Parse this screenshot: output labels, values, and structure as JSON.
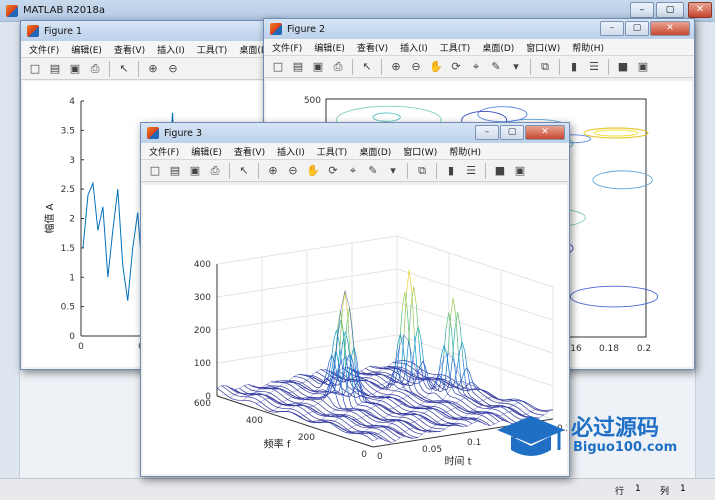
{
  "app": {
    "title": "MATLAB R2018a"
  },
  "windows": {
    "fig1": {
      "title": "Figure 1"
    },
    "fig2": {
      "title": "Figure 2"
    },
    "fig3": {
      "title": "Figure 3"
    }
  },
  "menu_full": [
    "文件(F)",
    "编辑(E)",
    "查看(V)",
    "插入(I)",
    "工具(T)",
    "桌面(D)",
    "窗口(W)",
    "帮助(H)"
  ],
  "menu_fig1": [
    "文件(F)",
    "编辑(E)",
    "查看(V)",
    "插入(I)",
    "工具(T)",
    "桌面(D"
  ],
  "status": {
    "row_label": "行",
    "row_value": "1",
    "col_label": "列",
    "col_value": "1"
  },
  "watermark": {
    "brand": "必过源码",
    "url": "Biguo100.com"
  },
  "chart_data": [
    {
      "type": "line",
      "figure": "Figure 1",
      "ylabel": "幅值 A",
      "ylim": [
        0,
        4
      ],
      "yticks": [
        "0",
        "0.5",
        "1",
        "1.5",
        "2",
        "2.5",
        "3",
        "3.5",
        "4"
      ],
      "xticks_visible": [
        "0",
        "0"
      ],
      "values": [
        1.5,
        2.4,
        2.6,
        1.8,
        2.2,
        1.0,
        1.8,
        2.5,
        1.2,
        0.6,
        1.5,
        2.1,
        1.0,
        2.5,
        2.6,
        1.8,
        1.2,
        2.3,
        3.8,
        2.2,
        3.3,
        2.2,
        1.0,
        1.6,
        2.4,
        3.1,
        1.8,
        0.9,
        1.6,
        0.5,
        1.3,
        2.2,
        1.7,
        2.6,
        3.4,
        2.7,
        1.5,
        2.2
      ]
    },
    {
      "type": "contour",
      "figure": "Figure 2",
      "yticks_visible": [
        "500"
      ],
      "xticks_visible": [
        "16",
        "0.18",
        "0.2"
      ]
    },
    {
      "type": "mesh",
      "figure": "Figure 3",
      "zlim": [
        0,
        400
      ],
      "zticks": [
        "0",
        "100",
        "200",
        "300",
        "400"
      ],
      "xlabel": "频率 f",
      "xticks": [
        "600",
        "400",
        "200",
        "0"
      ],
      "ylabel": "时间 t",
      "yticks": [
        "0",
        "0.05",
        "0.1",
        "0.15",
        "0.2"
      ],
      "peaks": [
        {
          "f": 380,
          "t": 0.15,
          "z": 370
        },
        {
          "f": 280,
          "t": 0.17,
          "z": 320
        },
        {
          "f": 350,
          "t": 0.07,
          "z": 355
        },
        {
          "f": 470,
          "t": 0.1,
          "z": 220
        }
      ]
    }
  ]
}
